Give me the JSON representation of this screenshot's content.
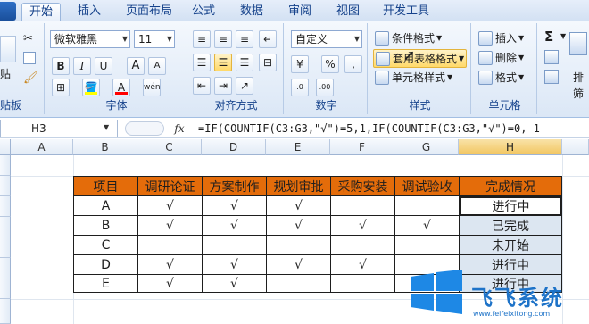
{
  "tabs": [
    "开始",
    "插入",
    "页面布局",
    "公式",
    "数据",
    "审阅",
    "视图",
    "开发工具"
  ],
  "ribbon": {
    "clipboard": {
      "label": "贴板",
      "paste": "贴"
    },
    "font": {
      "name": "微软雅黑",
      "size": "11",
      "bold": "B",
      "italic": "I",
      "underline": "U",
      "grow": "A",
      "shrink": "A",
      "fill_color": "#ffff00",
      "font_color": "#ff0000",
      "phonetic": "wén",
      "label": "字体"
    },
    "alignment": {
      "label": "对齐方式"
    },
    "number": {
      "format": "自定义",
      "percent": "%",
      "comma": ",",
      "label": "数字"
    },
    "styles": {
      "conditional": "条件格式",
      "table": "套用表格格式",
      "cell": "单元格样式",
      "label": "样式"
    },
    "cells": {
      "insert": "插入",
      "delete": "删除",
      "format": "格式",
      "label": "单元格"
    },
    "editing": {
      "sigma": "Σ",
      "sort": "排",
      "find": "筛"
    }
  },
  "formula_bar": {
    "name_box": "H3",
    "fx": "fx",
    "formula": "=IF(COUNTIF(C3:G3,\"√\")=5,1,IF(COUNTIF(C3:G3,\"√\")=0,-1"
  },
  "columns": [
    "A",
    "B",
    "C",
    "D",
    "E",
    "F",
    "G",
    "H"
  ],
  "table": {
    "headers": [
      "项目",
      "调研论证",
      "方案制作",
      "规划审批",
      "采购安装",
      "调试验收",
      "完成情况"
    ],
    "rows": [
      [
        "A",
        "√",
        "√",
        "√",
        "",
        "",
        "进行中"
      ],
      [
        "B",
        "√",
        "√",
        "√",
        "√",
        "√",
        "已完成"
      ],
      [
        "C",
        "",
        "",
        "",
        "",
        "",
        "未开始"
      ],
      [
        "D",
        "√",
        "√",
        "√",
        "√",
        "",
        "进行中"
      ],
      [
        "E",
        "√",
        "√",
        "",
        "",
        "",
        "进行中"
      ]
    ]
  },
  "watermark": {
    "title": "飞飞系统",
    "url": "www.feifeixitong.com"
  }
}
